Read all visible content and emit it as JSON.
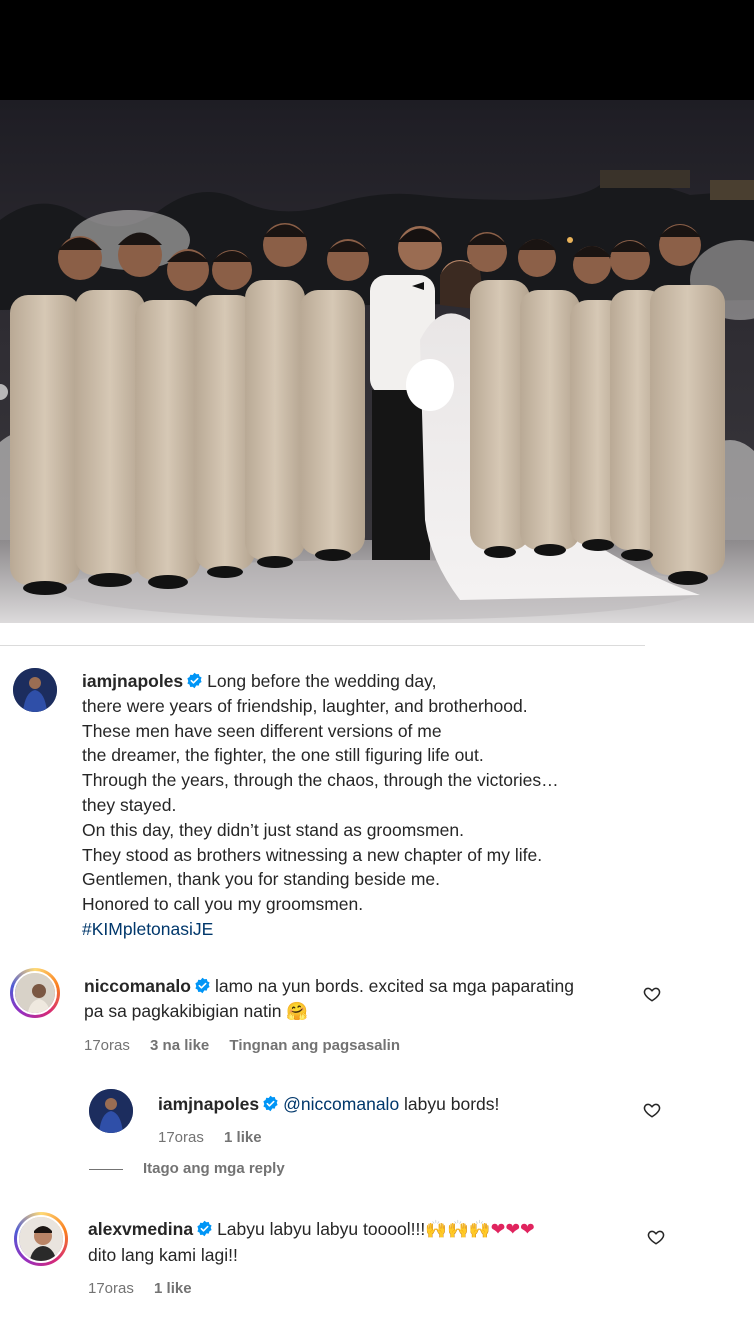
{
  "post": {
    "author": "iamjnapoles",
    "caption_lines": [
      "Long before the wedding day,",
      "there were years of friendship, laughter, and brotherhood.",
      "These men have seen different versions of me",
      "the dreamer, the fighter, the one still figuring life out.",
      "Through the years, through the chaos, through the victories…",
      "they stayed.",
      "On this day, they didn’t just stand as groomsmen.",
      "They stood as brothers witnessing a new chapter of my life.",
      "Gentlemen, thank you for standing beside me.",
      "Honored to call you my groomsmen."
    ],
    "hashtag": "#KIMpletonasiJE"
  },
  "comments": [
    {
      "username": "niccomanalo",
      "line1": "lamo na yun bords. excited sa mga paparating",
      "line2": "pa sa pagkakibigian natin",
      "emoji": "🤗",
      "time": "17oras",
      "likes": "3 na like",
      "translate": "Tingnan ang pagsasalin"
    },
    {
      "username": "iamjnapoles",
      "mention": "@niccomanalo",
      "text": "labyu bords!",
      "time": "17oras",
      "likes": "1 like"
    },
    {
      "username": "alexvmedina",
      "line1": "Labyu labyu labyu tooool!!!",
      "emojis": "🙌🙌🙌",
      "hearts": "❤❤❤",
      "line2": "dito lang kami lagi!!",
      "time": "17oras",
      "likes": "1 like"
    }
  ],
  "hide_replies_label": "Itago ang mga reply",
  "colors": {
    "link": "#00376b",
    "verified": "#0095f6",
    "meta": "#737373"
  },
  "icons": {
    "verified": "verified-badge-icon",
    "heart": "heart-outline-icon"
  }
}
